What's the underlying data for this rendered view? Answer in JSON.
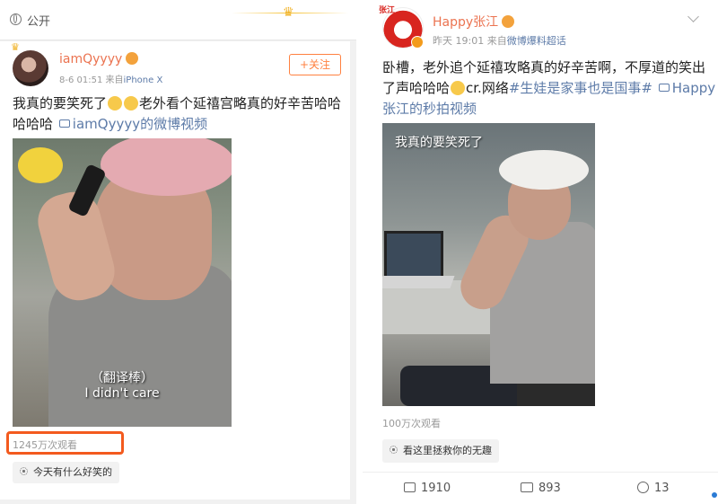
{
  "left": {
    "header": {
      "visibility_label": "公开"
    },
    "post": {
      "username": "iamQyyyy",
      "time": "8-6 01:51",
      "source_prefix": "来自",
      "device": "iPhone X",
      "follow_label": "+关注",
      "text_part1": "我真的要笑死了",
      "text_part2": "老外看个延禧宫略真的好辛苦哈哈哈哈哈",
      "video_link": "iamQyyyy的微博视频",
      "subtitle_1": "（翻译棒）",
      "subtitle_2": "I didn't care",
      "views": "1245万次观看",
      "tag": "今天有什么好笑的"
    }
  },
  "right": {
    "post": {
      "avatar_text": "张江",
      "username": "Happy张江",
      "time": "昨天 19:01",
      "source_prefix": "来自",
      "source": "微博爆料超话",
      "text_part1": "卧槽，老外追个延禧攻略真的好辛苦啊，不厚道的笑出了声哈哈哈",
      "text_part2": "cr.网络",
      "hashtag": "#生娃是家事也是国事#",
      "video_link": "Happy张江的秒拍视频",
      "video_title": "我真的要笑死了",
      "views": "100万次观看",
      "tag": "看这里拯救你的无趣",
      "reposts": "1910",
      "comments": "893",
      "likes": "13"
    }
  },
  "colors": {
    "username": "#eb7350",
    "link": "#5d7ba8",
    "follow": "#ff8140",
    "highlight_box": "#f35a1e"
  }
}
